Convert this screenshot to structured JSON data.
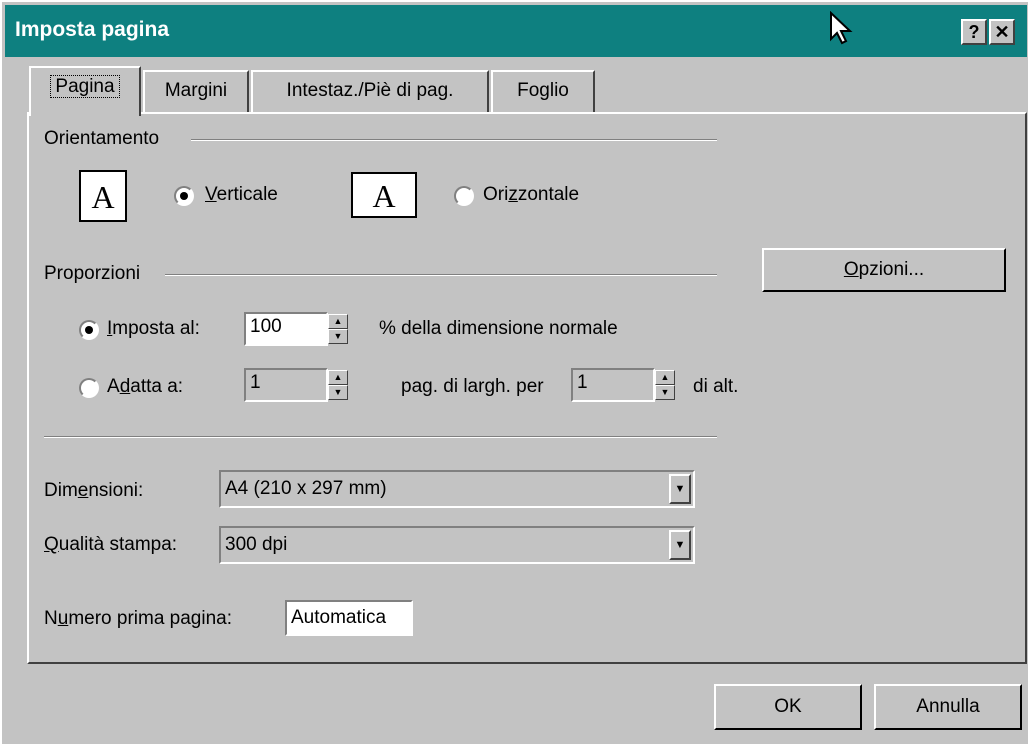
{
  "window": {
    "title": "Imposta pagina",
    "help_button": "?",
    "close_button": "✕",
    "title_bar_color": "#0e8080"
  },
  "tabs": [
    {
      "label": "Pagina",
      "active": true
    },
    {
      "label": "Margini",
      "active": false
    },
    {
      "label": "Intestaz./Piè di pag.",
      "active": false
    },
    {
      "label": "Foglio",
      "active": false
    }
  ],
  "orientation": {
    "heading": "Orientamento",
    "icon_letter": "A",
    "portrait": {
      "pre": "",
      "accel": "V",
      "post": "erticale",
      "selected": true
    },
    "landscape": {
      "pre": "Ori",
      "accel": "z",
      "post": "zontale",
      "selected": false
    }
  },
  "scaling": {
    "heading": "Proporzioni",
    "options_button": {
      "accel": "O",
      "post": "pzioni..."
    },
    "adjust": {
      "accel": "I",
      "post": "mposta al:",
      "value": "100",
      "suffix": "% della dimensione normale",
      "selected": true
    },
    "fit": {
      "pre": "A",
      "accel": "d",
      "post": "atta a:",
      "wide_value": "1",
      "wide_suffix": "pag. di largh. per",
      "tall_value": "1",
      "tall_suffix": "di alt.",
      "selected": false
    }
  },
  "paper": {
    "size_label": {
      "pre": "Dim",
      "accel": "e",
      "post": "nsioni:"
    },
    "size_value": "A4 (210 x 297 mm)",
    "quality_label": {
      "pre": "",
      "accel": "Q",
      "post": "ualità stampa:"
    },
    "quality_value": "300 dpi",
    "first_page_label": {
      "pre": "N",
      "accel": "u",
      "post": "mero prima pagina:"
    },
    "first_page_value": "Automatica"
  },
  "buttons": {
    "ok": "OK",
    "cancel": "Annulla"
  }
}
